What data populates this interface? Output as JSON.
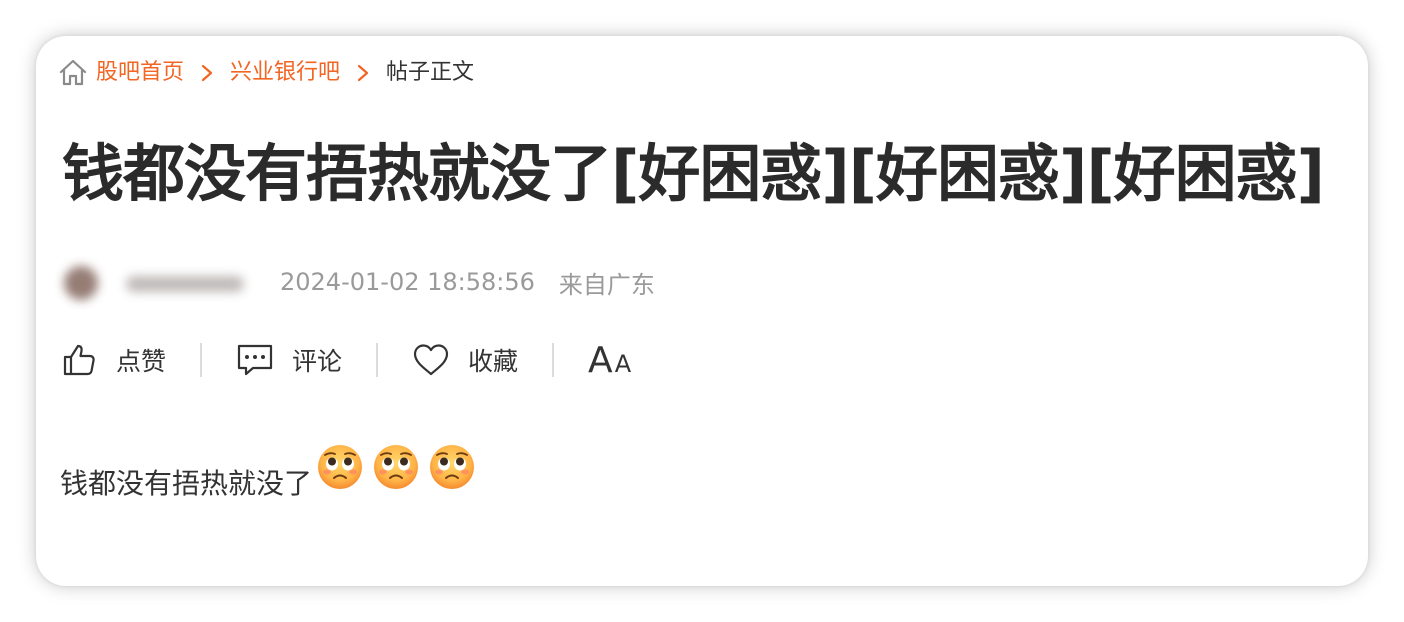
{
  "breadcrumb": {
    "home_icon": "home-icon",
    "items": [
      "股吧首页",
      "兴业银行吧"
    ],
    "current": "帖子正文"
  },
  "post": {
    "title": "钱都没有捂热就没了[好困惑][好困惑][好困惑]",
    "timestamp": "2024-01-02 18:58:56",
    "location": "来自广东",
    "content_text": "钱都没有捂热就没了",
    "content_emoji_count": 3
  },
  "actions": {
    "like": "点赞",
    "comment": "评论",
    "favorite": "收藏",
    "font_size_big": "A",
    "font_size_small": "A"
  },
  "colors": {
    "link": "#f26522",
    "title": "#2b2b2b",
    "meta": "#9a9a9a"
  }
}
